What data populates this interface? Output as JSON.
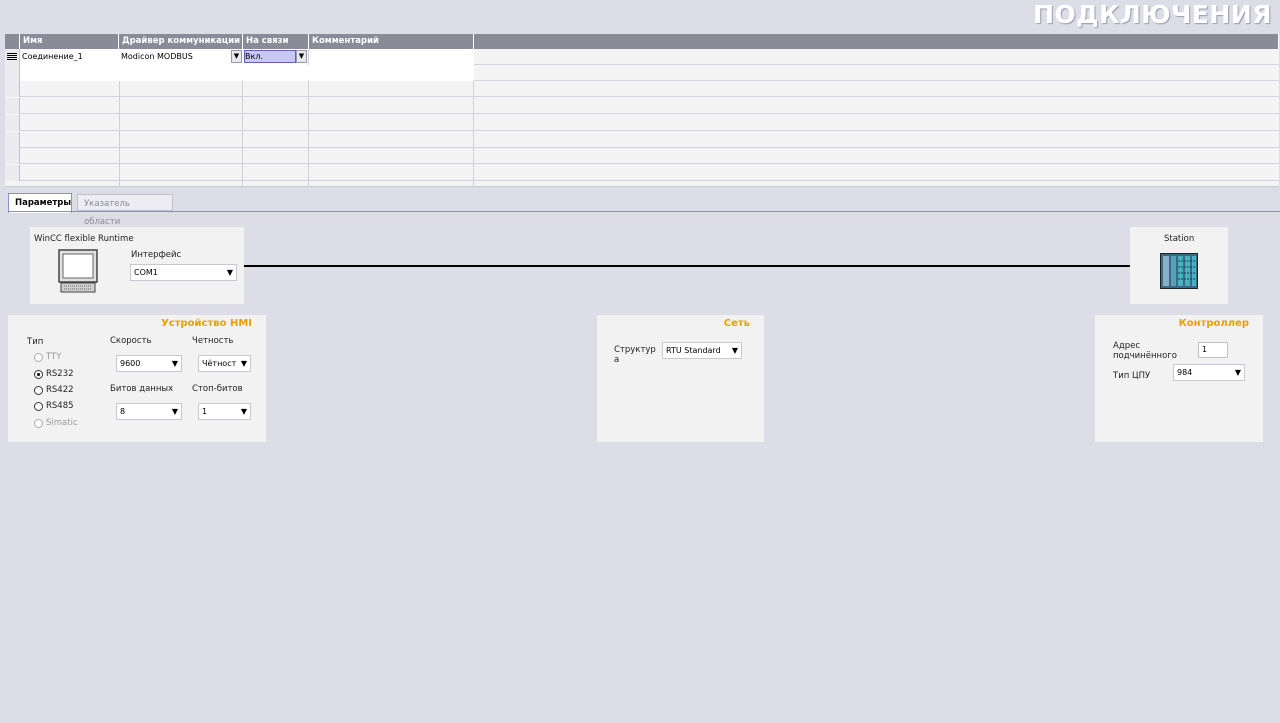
{
  "page_title": "ПОДКЛЮЧЕНИЯ",
  "table": {
    "columns": [
      "Имя",
      "Драйвер коммуникации",
      "На связи",
      "Комментарий"
    ],
    "rows": [
      {
        "name": "Соединение_1",
        "driver": "Modicon MODBUS",
        "online": "Вкл.",
        "comment": ""
      }
    ]
  },
  "tabs": [
    {
      "label": "Параметры",
      "active": true
    },
    {
      "label": "Указатель области",
      "active": false
    }
  ],
  "hmi_device_box": {
    "title": "WinCC flexible Runtime",
    "interface_label": "Интерфейс",
    "interface_value": "COM1"
  },
  "station_box": {
    "title": "Station"
  },
  "hmi_panel": {
    "title": "Устройство HMI",
    "type_label": "Тип",
    "types": [
      {
        "label": "TTY",
        "selected": false,
        "enabled": false
      },
      {
        "label": "RS232",
        "selected": true,
        "enabled": true
      },
      {
        "label": "RS422",
        "selected": false,
        "enabled": true
      },
      {
        "label": "RS485",
        "selected": false,
        "enabled": true
      },
      {
        "label": "Simatic",
        "selected": false,
        "enabled": false
      }
    ],
    "speed_label": "Скорость",
    "speed_value": "9600",
    "parity_label": "Четность",
    "parity_value": "Чётност",
    "databits_label": "Битов данных",
    "databits_value": "8",
    "stopbits_label": "Стоп-битов",
    "stopbits_value": "1"
  },
  "network_panel": {
    "title": "Сеть",
    "structure_label_1": "Структур",
    "structure_label_2": "а",
    "structure_value": "RTU Standard"
  },
  "controller_panel": {
    "title": "Контроллер",
    "slave_address_label_1": "Адрес",
    "slave_address_label_2": "подчинённого",
    "slave_address_value": "1",
    "cpu_type_label": "Тип ЦПУ",
    "cpu_type_value": "984"
  },
  "colors": {
    "accent": "#e8a000",
    "header": "#8a8a98",
    "background": "#dddde8"
  }
}
